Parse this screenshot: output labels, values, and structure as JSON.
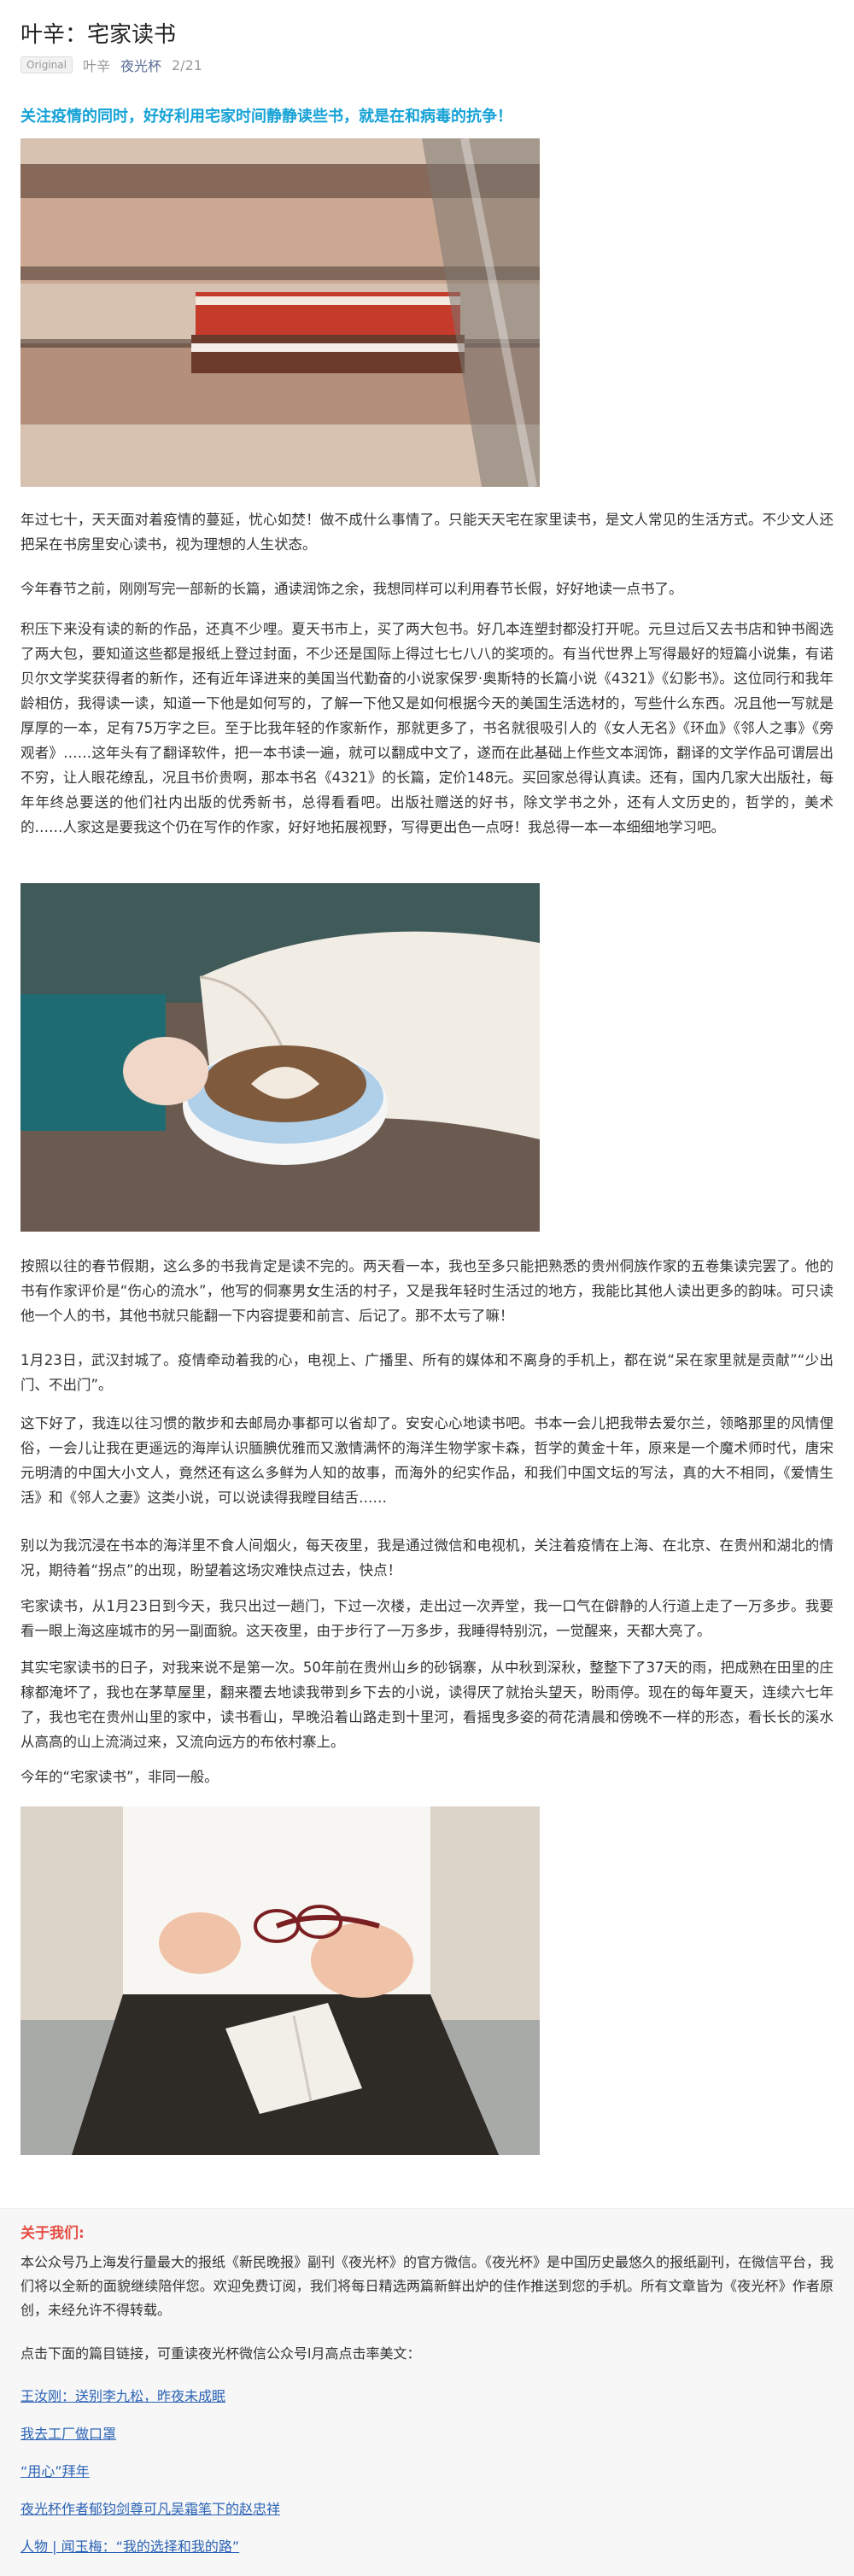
{
  "header": {
    "title": "叶辛：宅家读书",
    "original_badge": "Original",
    "author": "叶辛",
    "account": "夜光杯",
    "date": "2/21"
  },
  "article": {
    "intro": "关注疫情的同时，好好利用宅家时间静静读些书，就是在和病毒的抗争！",
    "paragraphs": [
      "年过七十，天天面对着疫情的蔓延，忧心如焚！做不成什么事情了。只能天天宅在家里读书，是文人常见的生活方式。不少文人还把呆在书房里安心读书，视为理想的人生状态。",
      "今年春节之前，刚刚写完一部新的长篇，通读润饰之余，我想同样可以利用春节长假，好好地读一点书了。",
      "积压下来没有读的新的作品，还真不少哩。夏天书市上，买了两大包书。好几本连塑封都没打开呢。元旦过后又去书店和钟书阁选了两大包，要知道这些都是报纸上登过封面，不少还是国际上得过七七八八的奖项的。有当代世界上写得最好的短篇小说集，有诺贝尔文学奖获得者的新作，还有近年译进来的美国当代勤奋的小说家保罗·奥斯特的长篇小说《4321》《幻影书》。这位同行和我年龄相仿，我得读一读，知道一下他是如何写的，了解一下他又是如何根据今天的美国生活选材的，写些什么东西。况且他一写就是厚厚的一本，足有75万字之巨。至于比我年轻的作家新作，那就更多了，书名就很吸引人的《女人无名》《环血》《邻人之事》《旁观者》……这年头有了翻译软件，把一本书读一遍，就可以翻成中文了，遂而在此基础上作些文本润饰，翻译的文学作品可谓层出不穷，让人眼花缭乱，况且书价贵啊，那本书名《4321》的长篇，定价148元。买回家总得认真读。还有，国内几家大出版社，每年年终总要送的他们社内出版的优秀新书，总得看看吧。出版社赠送的好书，除文学书之外，还有人文历史的，哲学的，美术的……人家这是要我这个仍在写作的作家，好好地拓展视野，写得更出色一点呀！我总得一本一本细细地学习吧。",
      "按照以往的春节假期，这么多的书我肯定是读不完的。两天看一本，我也至多只能把熟悉的贵州侗族作家的五卷集读完罢了。他的书有作家评价是“伤心的流水”，他写的侗寨男女生活的村子，又是我年轻时生活过的地方，我能比其他人读出更多的韵味。可只读他一个人的书，其他书就只能翻一下内容提要和前言、后记了。那不太亏了嘛！",
      "1月23日，武汉封城了。疫情牵动着我的心，电视上、广播里、所有的媒体和不离身的手机上，都在说“呆在家里就是贡献”“少出门、不出门”。",
      "这下好了，我连以往习惯的散步和去邮局办事都可以省却了。安安心心地读书吧。书本一会儿把我带去爱尔兰，领略那里的风情俚俗，一会儿让我在更遥远的海岸认识腼腆优雅而又激情满怀的海洋生物学家卡森，哲学的黄金十年，原来是一个魔术师时代，唐宋元明清的中国大小文人，竟然还有这么多鲜为人知的故事，而海外的纪实作品，和我们中国文坛的写法，真的大不相同，《爱情生活》和《邻人之妻》这类小说，可以说读得我瞠目结舌……",
      "别以为我沉浸在书本的海洋里不食人间烟火，每天夜里，我是通过微信和电视机，关注着疫情在上海、在北京、在贵州和湖北的情况，期待着“拐点”的出现，盼望着这场灾难快点过去，快点！",
      "宅家读书，从1月23日到今天，我只出过一趟门，下过一次楼，走出过一次弄堂，我一口气在僻静的人行道上走了一万多步。我要看一眼上海这座城市的另一副面貌。这天夜里，由于步行了一万多步，我睡得特别沉，一觉醒来，天都大亮了。",
      "其实宅家读书的日子，对我来说不是第一次。50年前在贵州山乡的砂锅寨，从中秋到深秋，整整下了37天的雨，把成熟在田里的庄稼都淹坏了，我也在茅草屋里，翻来覆去地读我带到乡下去的小说，读得厌了就抬头望天，盼雨停。现在的每年夏天，连续六七年了，我也宅在贵州山里的家中，读书看山，早晚沿着山路走到十里河，看摇曳多姿的荷花清晨和傍晚不一样的形态，看长长的溪水从高高的山上流淌过来，又流向远方的布依村寨上。",
      "今年的“宅家读书”，非同一般。"
    ]
  },
  "footer": {
    "about_title": "关于我们:",
    "about_text": "本公众号乃上海发行量最大的报纸《新民晚报》副刊《夜光杯》的官方微信。《夜光杯》是中国历史最悠久的报纸副刊，在微信平台，我们将以全新的面貌继续陪伴您。欢迎免费订阅，我们将每日精选两篇新鲜出炉的佳作推送到您的手机。所有文章皆为《夜光杯》作者原创，未经允许不得转载。",
    "links_intro": "点击下面的篇目链接，可重读夜光杯微信公众号l月高点击率美文：",
    "links": [
      "王汝刚：送别李九松，昨夜未成眠",
      "我去工厂做口罩",
      "“用心”拜年",
      "夜光杯作者郁钧剑尊可凡吴霜笔下的赵忠祥",
      "人物 | 闻玉梅：“我的选择和我的路”"
    ]
  },
  "images": {
    "img1": "books-on-stairs-image",
    "img2": "coffee-and-book-image",
    "img3": "reading-person-image"
  }
}
